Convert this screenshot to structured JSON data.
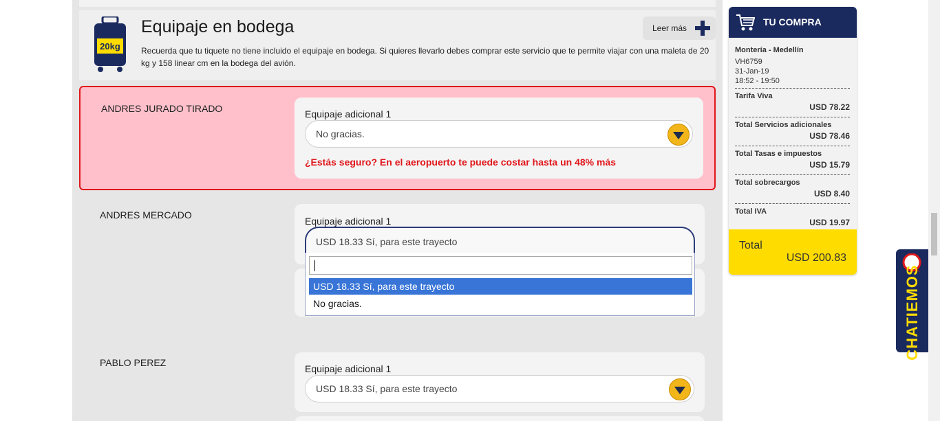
{
  "section": {
    "title": "Equipaje en bodega",
    "description": "Recuerda que tu tiquete no tiene incluido el equipaje en bodega. Si quieres llevarlo debes comprar este servicio que te permite viajar con una maleta de 20 kg y 158 linear cm en la bodega del avión.",
    "more_label": "Leer más",
    "bag_text": "20kg"
  },
  "passengers": [
    {
      "name": "ANDRES JURADO TIRADO",
      "field_label": "Equipaje adicional 1",
      "selected": "No gracias.",
      "warning": "¿Estás seguro? En el aeropuerto te puede costar hasta un 48% más"
    },
    {
      "name": "ANDRES MERCADO",
      "field_label": "Equipaje adicional 1",
      "selected": "USD 18.33 Sí, para este trayecto",
      "search_value": "",
      "options": [
        "USD 18.33 Sí, para este trayecto",
        "No gracias."
      ]
    },
    {
      "name": "PABLO PEREZ",
      "field_label": "Equipaje adicional 1",
      "selected": "USD 18.33 Sí, para este trayecto"
    }
  ],
  "cart": {
    "title": "TU COMPRA",
    "route": "Montería - Medellín",
    "flight": "VH6759",
    "date": "31-Jan-19",
    "time": "18:52 - 19:50",
    "rows": [
      {
        "label": "Tarifa Viva",
        "value": "USD 78.22"
      },
      {
        "label": "Total Servicios adicionales",
        "value": "USD 78.46"
      },
      {
        "label": "Total Tasas e impuestos",
        "value": "USD 15.79"
      },
      {
        "label": "Total sobrecargos",
        "value": "USD 8.40"
      },
      {
        "label": "Total IVA",
        "value": "USD 19.97"
      }
    ],
    "total_label": "Total",
    "total_value": "USD 200.83"
  },
  "chat": {
    "label": "CHATIEMOS"
  },
  "colors": {
    "brand_navy": "#1b2a5e",
    "accent_yellow": "#ffdc00",
    "error_red": "#e0161b",
    "error_bg": "#ffc0cb"
  }
}
